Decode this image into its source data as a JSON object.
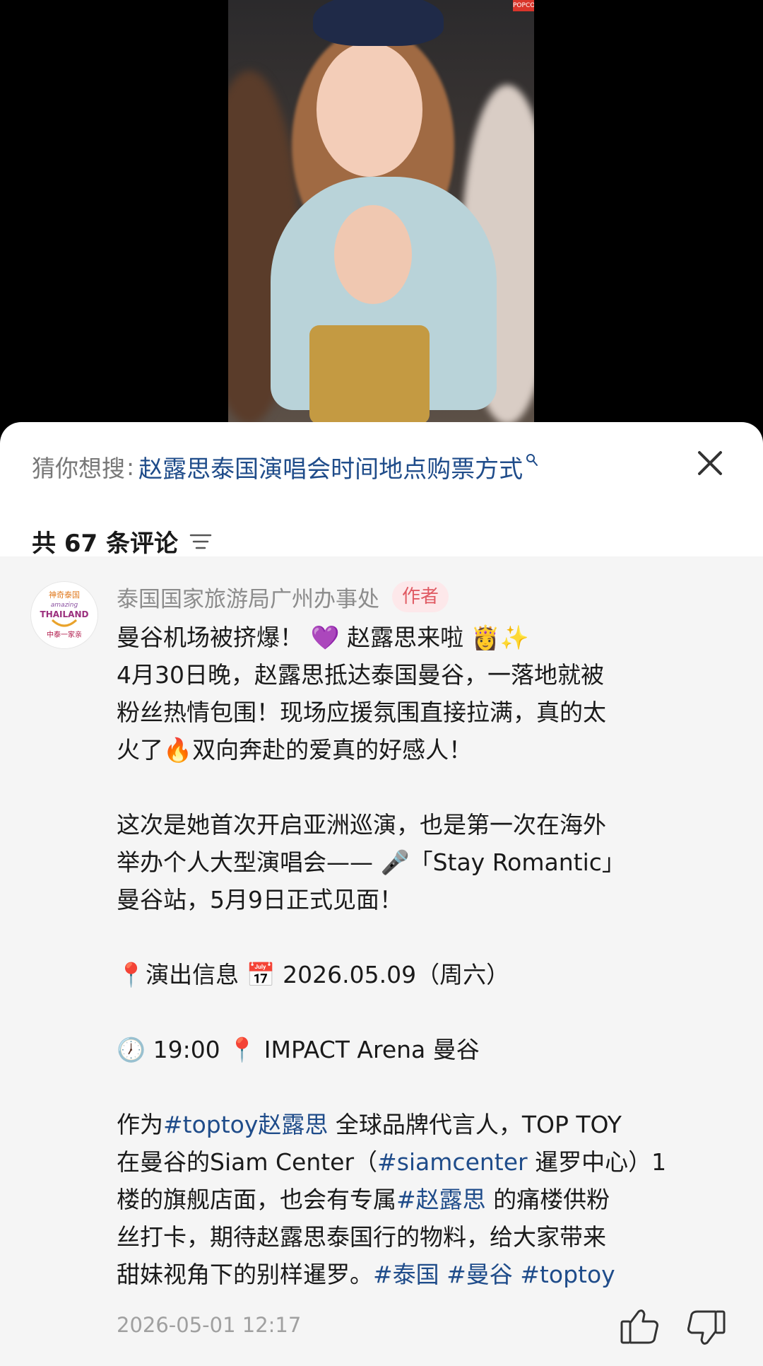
{
  "video": {
    "corner_badge": "POPCO"
  },
  "search": {
    "label": "猜你想搜",
    "separator": ":",
    "query": "赵露思泰国演唱会时间地点购票方式"
  },
  "comments_header": {
    "count_text": "共 67 条评论"
  },
  "comment": {
    "avatar_text_top": "神奇泰国",
    "avatar_text_mid": "amazing",
    "avatar_text_brand": "THAILAND",
    "avatar_text_bottom": "中泰一家亲",
    "author": "泰国国家旅游局广州办事处",
    "author_badge": "作者",
    "lines": {
      "l1": "曼谷机场被挤爆！ 💜 赵露思来啦 👸✨",
      "l2": "4月30日晚，赵露思抵达泰国曼谷，一落地就被",
      "l3": "粉丝热情包围！现场应援氛围直接拉满，真的太",
      "l4": "火了🔥双向奔赴的爱真的好感人！",
      "l5": "这次是她首次开启亚洲巡演，也是第一次在海外",
      "l6": "举办个人大型演唱会—— 🎤「Stay Romantic」",
      "l7": "曼谷站，5月9日正式见面！",
      "l8": "📍演出信息 📅 2026.05.09（周六）",
      "l9": "🕖 19:00 📍 IMPACT Arena 曼谷"
    },
    "p4": {
      "a1": "作为",
      "t1": "#toptoy赵露思",
      "a2": " 全球品牌代言人，TOP TOY",
      "b1": "在曼谷的Siam Center（",
      "t2": "#siamcenter",
      "b2": " 暹罗中心）1",
      "c1": "楼的旗舰店面，也会有专属",
      "t3": "#赵露思",
      "c2": " 的痛楼供粉",
      "d1": "丝打卡，期待赵露思泰国行的物料，给大家带来",
      "e1": "甜妹视角下的别样暹罗。",
      "t4": "#泰国",
      "t5": " #曼谷",
      "t6": " #toptoy"
    },
    "timestamp": "2026-05-01 12:17"
  },
  "icons": {
    "search": "search-icon",
    "close": "close-icon",
    "sort": "sort-icon",
    "like": "like-icon",
    "dislike": "dislike-icon"
  },
  "colors": {
    "hashtag": "#1f4c8a",
    "badge_bg": "#fde8ea",
    "badge_text": "#e05a63",
    "sheet_bg": "#ffffff",
    "comment_bg": "#f5f5f5"
  }
}
